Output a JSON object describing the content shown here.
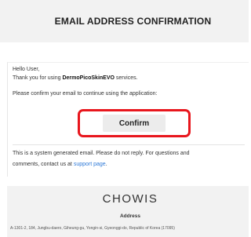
{
  "header": {
    "title": "EMAIL ADDRESS CONFIRMATION"
  },
  "body": {
    "greeting": "Hello User,",
    "thanks_prefix": "Thank you for using ",
    "brand_name": "DermoPicoSkinEVO",
    "thanks_suffix": " services.",
    "confirm_prompt": "Please confirm your email to continue using the application:",
    "confirm_label": "Confirm",
    "notice_line1": "This is a system generated email. Please do not reply. For questions and",
    "notice_line2_prefix": "comments, contact us at ",
    "support_link_text": "support page",
    "notice_line2_suffix": "."
  },
  "footer": {
    "logo_text": "CHOWIS",
    "address_label": "Address",
    "address": "A-1301-2, 184, Jungbu-daero, Giheung-gu, Yongin-si, Gyeonggi-do, Republic of Korea (17095)"
  },
  "colors": {
    "highlight_border": "#e8161d",
    "link": "#2f7ad8",
    "header_bg": "#f2f2f2",
    "button_bg": "#ececec"
  }
}
